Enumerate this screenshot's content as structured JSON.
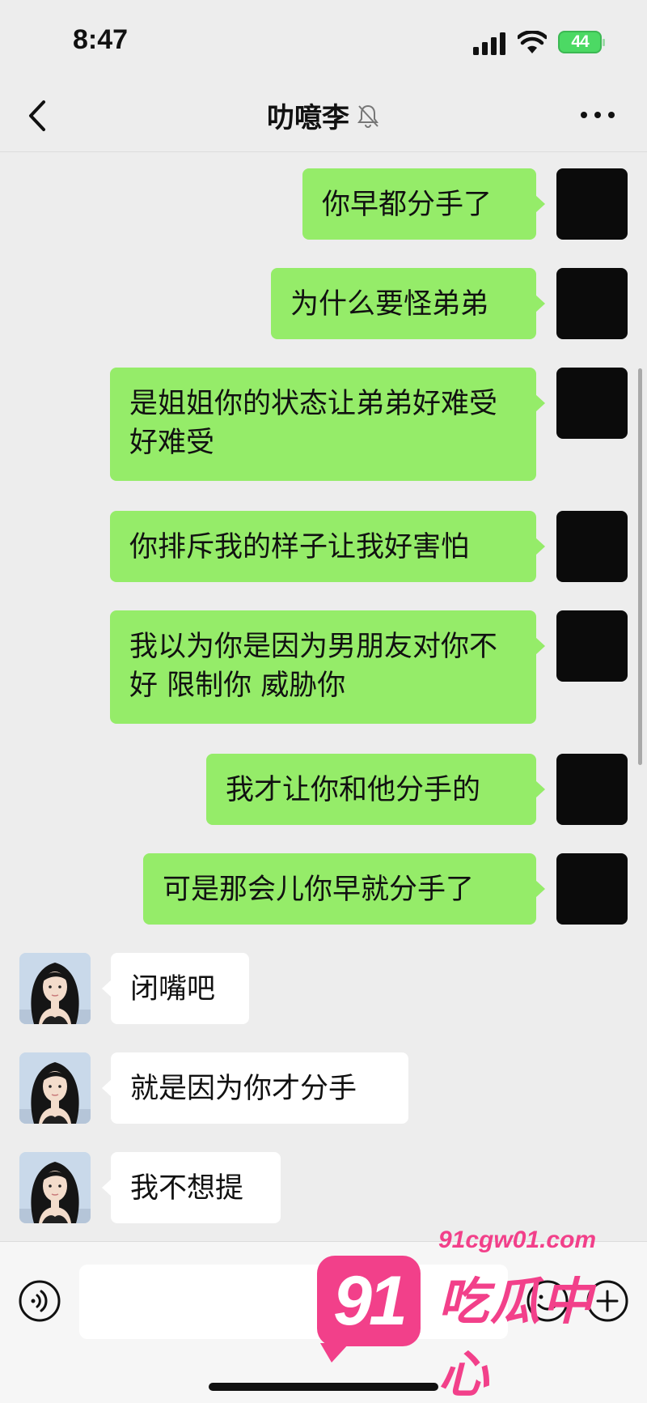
{
  "status_bar": {
    "time": "8:47",
    "battery": "44"
  },
  "header": {
    "title": "叻噫李"
  },
  "messages": [
    {
      "side": "out",
      "text": "你早都分手了"
    },
    {
      "side": "out",
      "text": "为什么要怪弟弟"
    },
    {
      "side": "out",
      "text": "是姐姐你的状态让弟弟好难受好难受"
    },
    {
      "side": "out",
      "text": "你排斥我的样子让我好害怕"
    },
    {
      "side": "out",
      "text": "我以为你是因为男朋友对你不好 限制你 威胁你"
    },
    {
      "side": "out",
      "text": "我才让你和他分手的"
    },
    {
      "side": "out",
      "text": "可是那会儿你早就分手了"
    },
    {
      "side": "in",
      "text": "闭嘴吧"
    },
    {
      "side": "in",
      "text": "就是因为你才分手"
    },
    {
      "side": "in",
      "text": "我不想提"
    }
  ],
  "input_bar": {
    "value": ""
  },
  "watermark": {
    "badge": "91",
    "url": "91cgw01.com",
    "name": "吃瓜中心"
  },
  "colors": {
    "outgoing_bubble": "#95ec69",
    "incoming_bubble": "#ffffff",
    "background": "#ededed",
    "watermark": "#f2408a"
  },
  "icons": [
    "signal-icon",
    "wifi-icon",
    "back-chevron-icon",
    "mute-bell-icon",
    "more-dots-icon",
    "voice-icon",
    "emoji-icon",
    "plus-icon"
  ]
}
